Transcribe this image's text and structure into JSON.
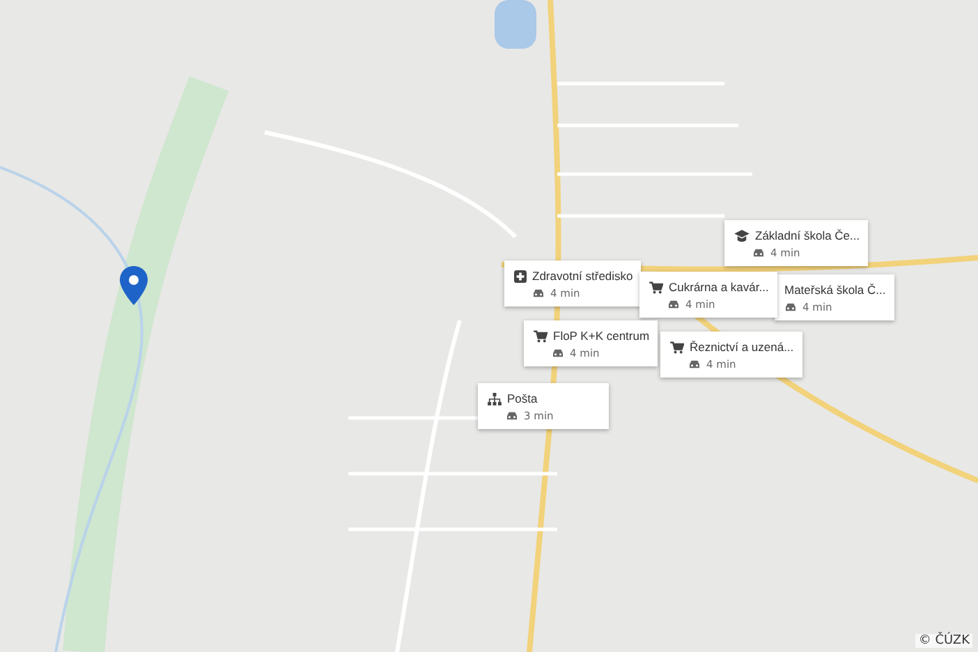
{
  "places": [
    {
      "kind": "school",
      "name": "Základní škola Če...",
      "time": "4 min"
    },
    {
      "kind": "none",
      "name": "Mateřská škola Č...",
      "time": "4 min"
    },
    {
      "kind": "health",
      "name": "Zdravotní středisko",
      "time": "4 min"
    },
    {
      "kind": "shop",
      "name": "Cukrárna a kavár...",
      "time": "4 min"
    },
    {
      "kind": "shop",
      "name": "FloP K+K centrum",
      "time": "4 min"
    },
    {
      "kind": "shop",
      "name": "Řeznictví a uzená...",
      "time": "4 min"
    },
    {
      "kind": "post",
      "name": "Pošta",
      "time": "3 min"
    }
  ],
  "attribution": "© ČÚZK"
}
